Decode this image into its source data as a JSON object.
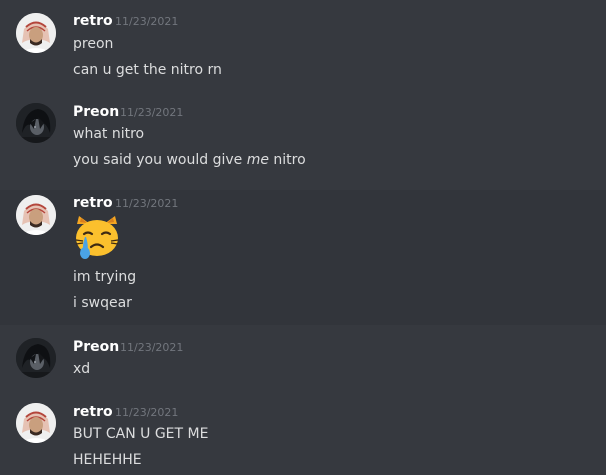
{
  "messages": [
    {
      "author": "retro",
      "timestamp": "11/23/2021",
      "avatar": "retro-avatar",
      "lines": [
        "preon",
        "can u get the nitro rn"
      ]
    },
    {
      "author": "Preon",
      "timestamp": "11/23/2021",
      "avatar": "preon-avatar",
      "lines": [
        "what nitro"
      ],
      "italic_line": {
        "before": "you said you would give ",
        "emphasis": "me",
        "after": " nitro"
      }
    },
    {
      "author": "retro",
      "timestamp": "11/23/2021",
      "avatar": "retro-avatar",
      "emoji": "crying-cat-face-emoji",
      "lines": [
        "im trying",
        "i swqear"
      ]
    },
    {
      "author": "Preon",
      "timestamp": "11/23/2021",
      "avatar": "preon-avatar",
      "lines": [
        "xd"
      ]
    },
    {
      "author": "retro",
      "timestamp": "11/23/2021",
      "avatar": "retro-avatar",
      "lines": [
        "BUT CAN U GET ME",
        "HEHEHHE"
      ]
    }
  ],
  "colors": {
    "background": "#36393f",
    "hover_background": "#32353b",
    "username": "#ffffff",
    "message_text": "#dcddde",
    "timestamp": "#72767d"
  }
}
